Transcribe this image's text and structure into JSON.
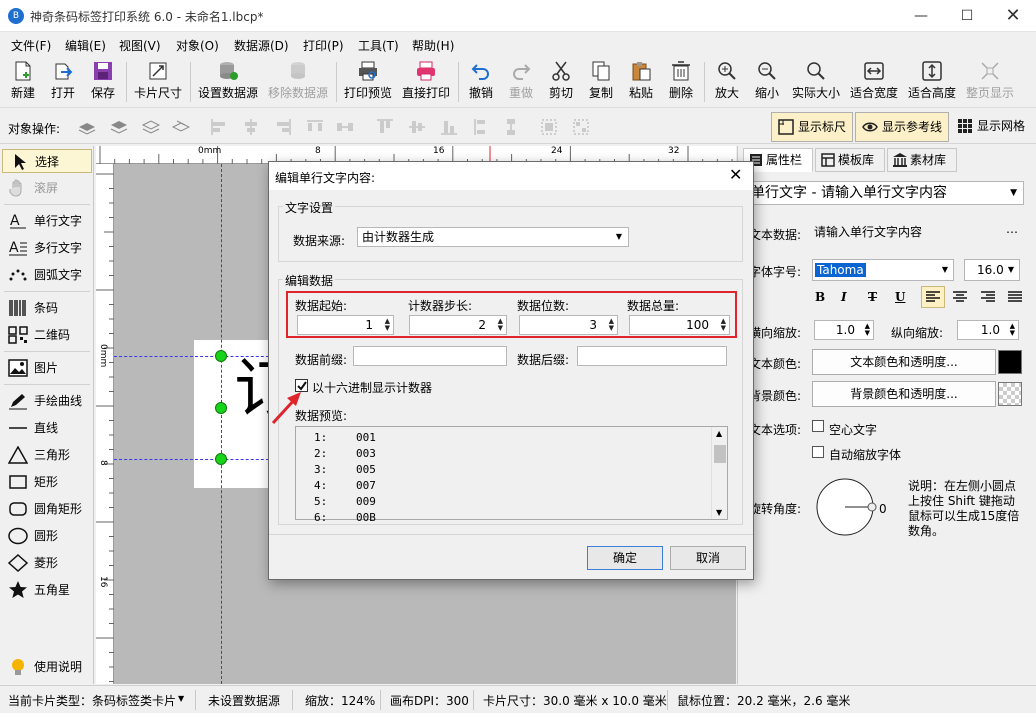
{
  "window": {
    "title": "神奇条码标签打印系统 6.0 - 未命名1.lbcp*",
    "app_icon": "B"
  },
  "menu": [
    "文件(F)",
    "编辑(E)",
    "视图(V)",
    "对象(O)",
    "数据源(D)",
    "打印(P)",
    "工具(T)",
    "帮助(H)"
  ],
  "toolbar": {
    "new": "新建",
    "open": "打开",
    "save": "保存",
    "card_size": "卡片尺寸",
    "set_datasource": "设置数据源",
    "remove_datasource": "移除数据源",
    "print_preview": "打印预览",
    "direct_print": "直接打印",
    "undo": "撤销",
    "redo": "重做",
    "cut": "剪切",
    "copy": "复制",
    "paste": "粘贴",
    "delete": "删除",
    "zoom_in": "放大",
    "zoom_out": "缩小",
    "actual_size": "实际大小",
    "fit_width": "适合宽度",
    "fit_height": "适合高度",
    "fit_page": "整页显示"
  },
  "objbar": {
    "label": "对象操作:",
    "show_ruler": "显示标尺",
    "show_guides": "显示参考线",
    "show_grid": "显示网格"
  },
  "tools": [
    "选择",
    "滚屏",
    "单行文字",
    "多行文字",
    "圆弧文字",
    "条码",
    "二维码",
    "图片",
    "手绘曲线",
    "直线",
    "三角形",
    "矩形",
    "圆角矩形",
    "圆形",
    "菱形",
    "五角星",
    "使用说明"
  ],
  "ruler": {
    "top": [
      "0mm",
      "8",
      "16",
      "24",
      "32"
    ],
    "left": [
      "0mm",
      "8",
      "16"
    ]
  },
  "canvas": {
    "big_char": "订"
  },
  "right": {
    "tabs": [
      "属性栏",
      "模板库",
      "素材库"
    ],
    "object_selector": "单行文字 - 请输入单行文字内容",
    "text_data_label": "文本数据:",
    "text_data_value": "请输入单行文字内容",
    "font_label": "字体字号:",
    "font_name": "Tahoma",
    "font_size": "16.0",
    "format_bold": "B",
    "format_italic": "I",
    "format_strike": "T",
    "format_underline": "U",
    "hscale_label": "横向缩放:",
    "hscale_value": "1.0",
    "vscale_label": "纵向缩放:",
    "vscale_value": "1.0",
    "text_color_label": "文本颜色:",
    "text_color_btn": "文本颜色和透明度...",
    "bg_color_label": "背景颜色:",
    "bg_color_btn": "背景颜色和透明度...",
    "text_options_label": "文本选项:",
    "hollow_text": "空心文字",
    "auto_shrink": "自动缩放字体",
    "rotation_label": "旋转角度:",
    "rotation_value": "0",
    "rotation_hint": "说明：在左侧小圆点上按住 Shift 键拖动鼠标可以生成15度倍数角。",
    "text_color_hex": "#000000"
  },
  "dialog": {
    "title": "编辑单行文字内容:",
    "group_text": "文字设置",
    "source_label": "数据来源:",
    "source_value": "由计数器生成",
    "group_edit": "编辑数据",
    "start_label": "数据起始:",
    "start_value": "1",
    "step_label": "计数器步长:",
    "step_value": "2",
    "digits_label": "数据位数:",
    "digits_value": "3",
    "total_label": "数据总量:",
    "total_value": "100",
    "prefix_label": "数据前缀:",
    "suffix_label": "数据后缀:",
    "hex_label": "以十六进制显示计数器",
    "hex_checked": true,
    "preview_label": "数据预览:",
    "preview": [
      {
        "n": "1:",
        "v": "001"
      },
      {
        "n": "2:",
        "v": "003"
      },
      {
        "n": "3:",
        "v": "005"
      },
      {
        "n": "4:",
        "v": "007"
      },
      {
        "n": "5:",
        "v": "009"
      },
      {
        "n": "6:",
        "v": "00B"
      }
    ],
    "ok": "确定",
    "cancel": "取消",
    "highlight_color": "#e0242c"
  },
  "status": {
    "card_type": "当前卡片类型：条码标签类卡片",
    "datasource": "未设置数据源",
    "zoom": "缩放：124%",
    "dpi": "画布DPI：300",
    "card_size": "卡片尺寸：30.0 毫米 x 10.0 毫米",
    "mouse_pos": "鼠标位置：20.2 毫米，2.6 毫米"
  }
}
